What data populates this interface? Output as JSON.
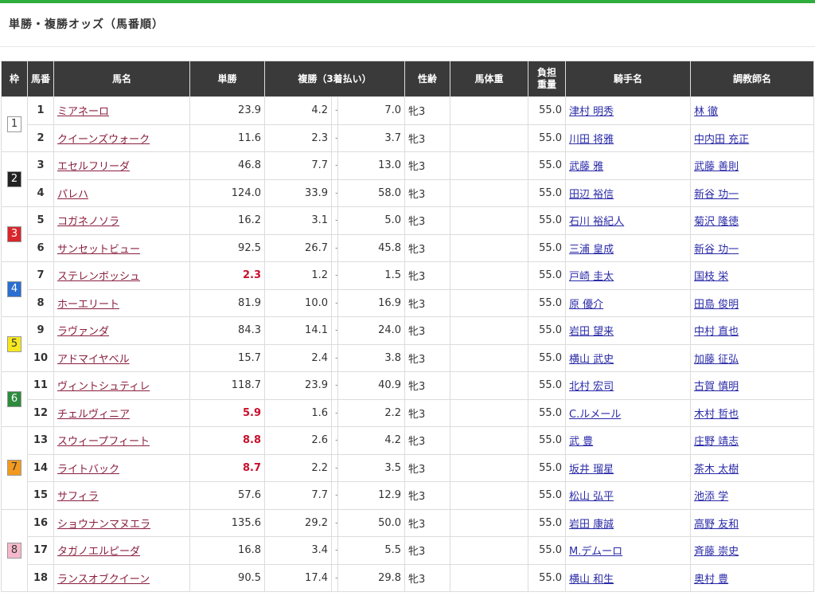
{
  "title": "単勝・複勝オッズ（馬番順）",
  "colors": {
    "accent": "#2fad3d",
    "header_bg": "#3a3a3a",
    "hot_odds": "#c8102e"
  },
  "headers": {
    "waku": "枠",
    "umaban": "馬番",
    "name": "馬名",
    "win": "単勝",
    "place": "複勝（3着払い）",
    "sexage": "性齢",
    "bodyweight": "馬体重",
    "weight_l1": "負担",
    "weight_l2": "重量",
    "jockey": "騎手名",
    "trainer": "調教師名"
  },
  "waku_groups": [
    {
      "label": "1",
      "bg": "#ffffff",
      "fg": "#333333",
      "rows": 2
    },
    {
      "label": "2",
      "bg": "#222222",
      "fg": "#ffffff",
      "rows": 2
    },
    {
      "label": "3",
      "bg": "#d9262c",
      "fg": "#ffffff",
      "rows": 2
    },
    {
      "label": "4",
      "bg": "#2a6fd1",
      "fg": "#ffffff",
      "rows": 2
    },
    {
      "label": "5",
      "bg": "#f5e720",
      "fg": "#333333",
      "rows": 2
    },
    {
      "label": "6",
      "bg": "#2e8b3d",
      "fg": "#ffffff",
      "rows": 2
    },
    {
      "label": "7",
      "bg": "#f29a1f",
      "fg": "#333333",
      "rows": 3
    },
    {
      "label": "8",
      "bg": "#f6b9cc",
      "fg": "#333333",
      "rows": 3
    }
  ],
  "horses": [
    {
      "umaban": "1",
      "name": "ミアネーロ",
      "win": "23.9",
      "place_min": "4.2",
      "place_max": "7.0",
      "sexage": "牝3",
      "bodyweight": "",
      "weight": "55.0",
      "jockey": "津村 明秀",
      "trainer": "林 徹",
      "hot": false
    },
    {
      "umaban": "2",
      "name": "クイーンズウォーク",
      "win": "11.6",
      "place_min": "2.3",
      "place_max": "3.7",
      "sexage": "牝3",
      "bodyweight": "",
      "weight": "55.0",
      "jockey": "川田 将雅",
      "trainer": "中内田 充正",
      "hot": false
    },
    {
      "umaban": "3",
      "name": "エセルフリーダ",
      "win": "46.8",
      "place_min": "7.7",
      "place_max": "13.0",
      "sexage": "牝3",
      "bodyweight": "",
      "weight": "55.0",
      "jockey": "武藤 雅",
      "trainer": "武藤 善則",
      "hot": false
    },
    {
      "umaban": "4",
      "name": "パレハ",
      "win": "124.0",
      "place_min": "33.9",
      "place_max": "58.0",
      "sexage": "牝3",
      "bodyweight": "",
      "weight": "55.0",
      "jockey": "田辺 裕信",
      "trainer": "新谷 功一",
      "hot": false
    },
    {
      "umaban": "5",
      "name": "コガネノソラ",
      "win": "16.2",
      "place_min": "3.1",
      "place_max": "5.0",
      "sexage": "牝3",
      "bodyweight": "",
      "weight": "55.0",
      "jockey": "石川 裕紀人",
      "trainer": "菊沢 隆徳",
      "hot": false
    },
    {
      "umaban": "6",
      "name": "サンセットビュー",
      "win": "92.5",
      "place_min": "26.7",
      "place_max": "45.8",
      "sexage": "牝3",
      "bodyweight": "",
      "weight": "55.0",
      "jockey": "三浦 皇成",
      "trainer": "新谷 功一",
      "hot": false
    },
    {
      "umaban": "7",
      "name": "ステレンボッシュ",
      "win": "2.3",
      "place_min": "1.2",
      "place_max": "1.5",
      "sexage": "牝3",
      "bodyweight": "",
      "weight": "55.0",
      "jockey": "戸崎 圭太",
      "trainer": "国枝 栄",
      "hot": true
    },
    {
      "umaban": "8",
      "name": "ホーエリート",
      "win": "81.9",
      "place_min": "10.0",
      "place_max": "16.9",
      "sexage": "牝3",
      "bodyweight": "",
      "weight": "55.0",
      "jockey": "原 優介",
      "trainer": "田島 俊明",
      "hot": false
    },
    {
      "umaban": "9",
      "name": "ラヴァンダ",
      "win": "84.3",
      "place_min": "14.1",
      "place_max": "24.0",
      "sexage": "牝3",
      "bodyweight": "",
      "weight": "55.0",
      "jockey": "岩田 望来",
      "trainer": "中村 直也",
      "hot": false
    },
    {
      "umaban": "10",
      "name": "アドマイヤベル",
      "win": "15.7",
      "place_min": "2.4",
      "place_max": "3.8",
      "sexage": "牝3",
      "bodyweight": "",
      "weight": "55.0",
      "jockey": "横山 武史",
      "trainer": "加藤 征弘",
      "hot": false
    },
    {
      "umaban": "11",
      "name": "ヴィントシュティレ",
      "win": "118.7",
      "place_min": "23.9",
      "place_max": "40.9",
      "sexage": "牝3",
      "bodyweight": "",
      "weight": "55.0",
      "jockey": "北村 宏司",
      "trainer": "古賀 慎明",
      "hot": false
    },
    {
      "umaban": "12",
      "name": "チェルヴィニア",
      "win": "5.9",
      "place_min": "1.6",
      "place_max": "2.2",
      "sexage": "牝3",
      "bodyweight": "",
      "weight": "55.0",
      "jockey": "C.ルメール",
      "trainer": "木村 哲也",
      "hot": true
    },
    {
      "umaban": "13",
      "name": "スウィープフィート",
      "win": "8.8",
      "place_min": "2.6",
      "place_max": "4.2",
      "sexage": "牝3",
      "bodyweight": "",
      "weight": "55.0",
      "jockey": "武 豊",
      "trainer": "庄野 靖志",
      "hot": true
    },
    {
      "umaban": "14",
      "name": "ライトバック",
      "win": "8.7",
      "place_min": "2.2",
      "place_max": "3.5",
      "sexage": "牝3",
      "bodyweight": "",
      "weight": "55.0",
      "jockey": "坂井 瑠星",
      "trainer": "茶木 太樹",
      "hot": true
    },
    {
      "umaban": "15",
      "name": "サフィラ",
      "win": "57.6",
      "place_min": "7.7",
      "place_max": "12.9",
      "sexage": "牝3",
      "bodyweight": "",
      "weight": "55.0",
      "jockey": "松山 弘平",
      "trainer": "池添 学",
      "hot": false
    },
    {
      "umaban": "16",
      "name": "ショウナンマヌエラ",
      "win": "135.6",
      "place_min": "29.2",
      "place_max": "50.0",
      "sexage": "牝3",
      "bodyweight": "",
      "weight": "55.0",
      "jockey": "岩田 康誠",
      "trainer": "高野 友和",
      "hot": false
    },
    {
      "umaban": "17",
      "name": "タガノエルピーダ",
      "win": "16.8",
      "place_min": "3.4",
      "place_max": "5.5",
      "sexage": "牝3",
      "bodyweight": "",
      "weight": "55.0",
      "jockey": "M.デムーロ",
      "trainer": "斉藤 崇史",
      "hot": false
    },
    {
      "umaban": "18",
      "name": "ランスオブクイーン",
      "win": "90.5",
      "place_min": "17.4",
      "place_max": "29.8",
      "sexage": "牝3",
      "bodyweight": "",
      "weight": "55.0",
      "jockey": "横山 和生",
      "trainer": "奥村 豊",
      "hot": false
    }
  ]
}
